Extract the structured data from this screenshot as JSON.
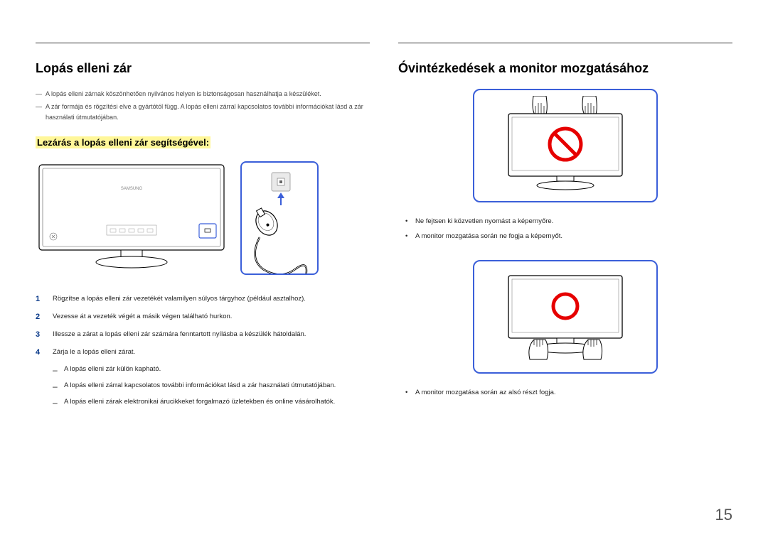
{
  "left": {
    "heading": "Lopás elleni zár",
    "notes": [
      "A lopás elleni zárnak köszönhetően nyilvános helyen is biztonságosan használhatja a készüléket.",
      "A zár formája és rögzítési elve a gyártótól függ. A lopás elleni zárral kapcsolatos további információkat lásd a zár használati útmutatójában."
    ],
    "subheading": "Lezárás a lopás elleni zár segítségével:",
    "steps": [
      "Rögzítse a lopás elleni zár vezetékét valamilyen súlyos tárgyhoz (például asztalhoz).",
      "Vezesse át a vezeték végét a másik végen található hurkon.",
      "Illessze a zárat a lopás elleni zár számára fenntartott nyílásba a készülék hátoldalán.",
      "Zárja le a lopás elleni zárat."
    ],
    "sub_dash": [
      "A lopás elleni zár külön kapható.",
      "A lopás elleni zárral kapcsolatos további információkat lásd a zár használati útmutatójában.",
      "A lopás elleni zárak elektronikai árucikkeket forgalmazó üzletekben és online vásárolhatók."
    ],
    "brand_label": "SAMSUNG"
  },
  "right": {
    "heading": "Óvintézkedések a monitor mozgatásához",
    "bullets_top": [
      "Ne fejtsen ki közvetlen nyomást a képernyőre.",
      "A monitor mozgatása során ne fogja a képernyőt."
    ],
    "bullets_bottom": [
      "A monitor mozgatása során az alsó részt fogja."
    ]
  },
  "page_number": "15"
}
